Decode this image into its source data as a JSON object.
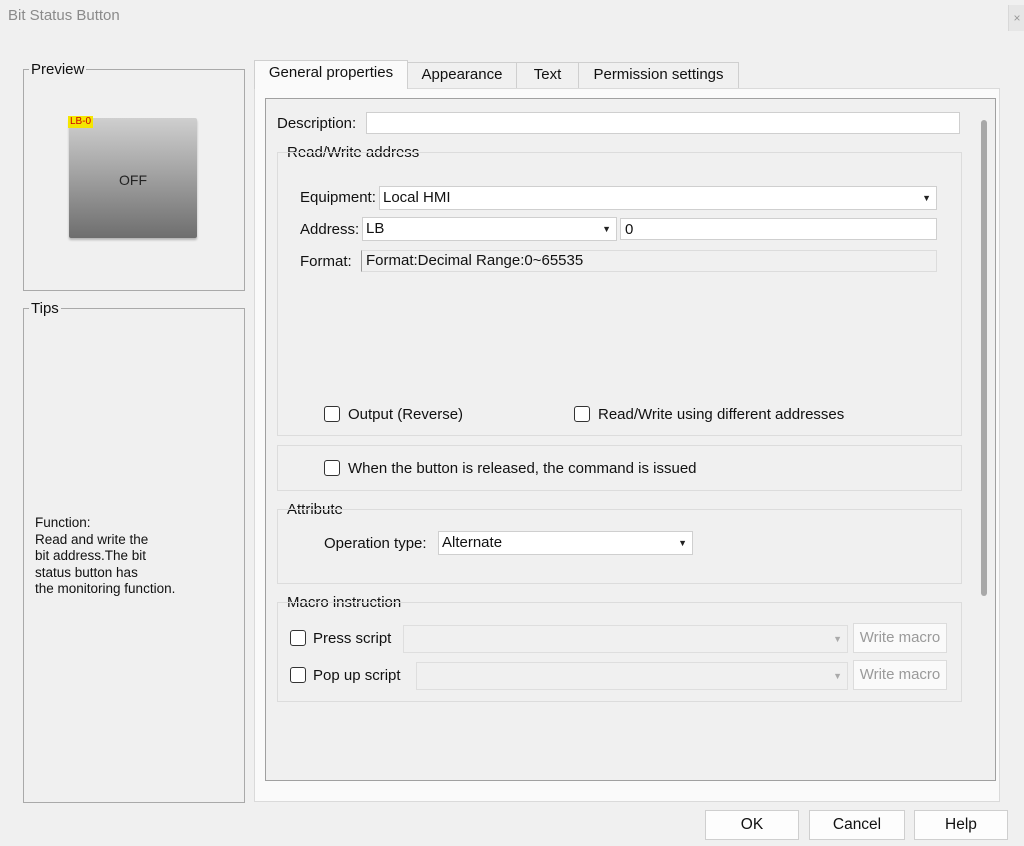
{
  "window": {
    "title": "Bit Status Button",
    "close_glyph": "×"
  },
  "preview": {
    "group_label": "Preview",
    "address_tag": "LB-0",
    "state_text": "OFF"
  },
  "tips": {
    "group_label": "Tips",
    "lines": [
      "Function:",
      "Read and write the",
      "bit address.The bit",
      "status button has",
      "the monitoring function."
    ]
  },
  "tabs": [
    {
      "label": "General properties",
      "active": true
    },
    {
      "label": "Appearance",
      "active": false
    },
    {
      "label": "Text",
      "active": false
    },
    {
      "label": "Permission settings",
      "active": false
    }
  ],
  "general": {
    "description": {
      "label": "Description:",
      "value": ""
    },
    "rw_address": {
      "group_label": "Read/Write address",
      "equipment": {
        "label": "Equipment:",
        "value": "Local HMI"
      },
      "address": {
        "label": "Address:",
        "type_value": "LB",
        "number_value": "0"
      },
      "format": {
        "label": "Format:",
        "value": "Format:Decimal  Range:0~65535"
      },
      "output_reverse": {
        "label": "Output (Reverse)",
        "checked": false
      },
      "rw_different": {
        "label": "Read/Write using different addresses",
        "checked": false
      }
    },
    "release_command": {
      "label": "When the button is released, the command is issued",
      "checked": false
    },
    "attribute": {
      "group_label": "Attribute",
      "operation_type": {
        "label": "Operation type:",
        "value": "Alternate"
      }
    },
    "macro": {
      "group_label": "Macro instruction",
      "press_script": {
        "label": "Press script",
        "checked": false,
        "value": "",
        "button": "Write macro"
      },
      "popup_script": {
        "label": "Pop up script",
        "checked": false,
        "value": "",
        "button": "Write macro"
      }
    }
  },
  "buttons": {
    "ok": "OK",
    "cancel": "Cancel",
    "help": "Help"
  }
}
